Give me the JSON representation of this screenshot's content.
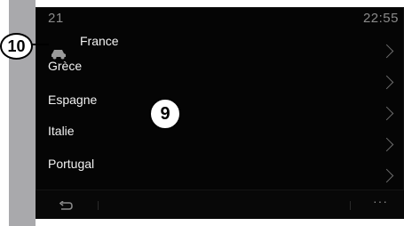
{
  "status_bar": {
    "temperature": "21",
    "time": "22:55"
  },
  "countries": [
    {
      "label": "France"
    },
    {
      "label": "Grèce"
    },
    {
      "label": "Espagne"
    },
    {
      "label": "Italie"
    },
    {
      "label": "Portugal"
    }
  ],
  "callouts": {
    "ten": "10",
    "nine": "9"
  },
  "icons": {
    "vehicle": "car-icon",
    "back": "back-arrow-icon",
    "more": "more-options-icon"
  },
  "more_glyph": "···"
}
